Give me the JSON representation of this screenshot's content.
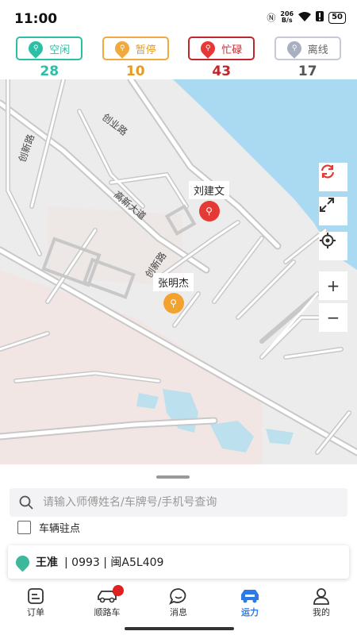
{
  "status_bar": {
    "time": "11:00",
    "net_speed": "206",
    "net_unit": "B/s",
    "battery": "50"
  },
  "chips": [
    {
      "key": "idle",
      "label": "空闲",
      "count": "28",
      "color": "#2bbfa4"
    },
    {
      "key": "paused",
      "label": "暂停",
      "count": "10",
      "color": "#f0a93a"
    },
    {
      "key": "busy",
      "label": "忙碌",
      "count": "43",
      "color": "#c0272d"
    },
    {
      "key": "offline",
      "label": "离线",
      "count": "17",
      "color": "#a8b0c0"
    }
  ],
  "map": {
    "roads": [
      "创业路",
      "高新大道",
      "创新路",
      "创新路"
    ],
    "markers": [
      {
        "name": "刘建文",
        "status": "busy",
        "color": "#e53935"
      },
      {
        "name": "张明杰",
        "status": "paused",
        "color": "#f2a22f"
      }
    ],
    "controls": [
      "refresh-icon",
      "expand-icon",
      "locate-icon",
      "+",
      "−"
    ]
  },
  "search": {
    "placeholder": "请输入师傅姓名/车牌号/手机号查询",
    "value": ""
  },
  "parking_checkbox": {
    "label": "车辆驻点",
    "checked": false
  },
  "driver_card": {
    "name": "王准",
    "info": "| 0993 | 闽A5L409",
    "color": "#3eb89b"
  },
  "tabs": [
    {
      "label": "订单",
      "icon": "order-icon"
    },
    {
      "label": "顺路车",
      "icon": "car-icon"
    },
    {
      "label": "消息",
      "icon": "message-icon"
    },
    {
      "label": "运力",
      "icon": "capacity-icon",
      "active": true
    },
    {
      "label": "我的",
      "icon": "profile-icon"
    }
  ]
}
